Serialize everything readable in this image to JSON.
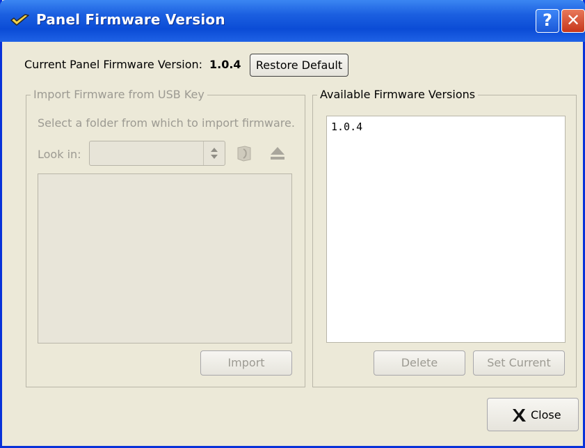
{
  "window": {
    "title": "Panel Firmware Version",
    "help_label": "?",
    "close_label": "✕"
  },
  "header": {
    "current_label": "Current Panel Firmware Version:",
    "current_value": "1.0.4",
    "restore_label": "Restore Default"
  },
  "import_group": {
    "legend": "Import Firmware from USB Key",
    "instruction": "Select a folder from which to import firmware.",
    "look_in_label": "Look in:",
    "look_in_value": "",
    "import_label": "Import"
  },
  "available_group": {
    "legend": "Available Firmware Versions",
    "versions": [
      "1.0.4"
    ],
    "delete_label": "Delete",
    "set_current_label": "Set Current"
  },
  "footer": {
    "close_label": "Close"
  },
  "icons": {
    "title_icon": "checkmark-icon",
    "folder_icon": "folder-icon",
    "eject_icon": "eject-icon",
    "close_icon": "x-icon"
  },
  "colors": {
    "titlebar": "#0b4cd6",
    "window_bg": "#ece9d8",
    "close_button": "#c6361b"
  }
}
